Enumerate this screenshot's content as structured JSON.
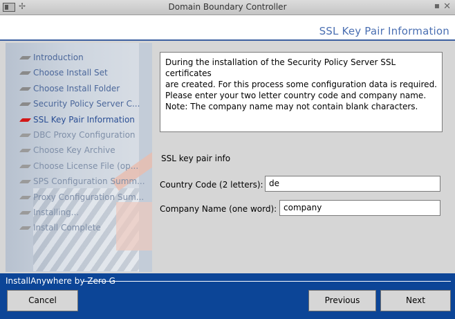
{
  "window": {
    "title": "Domain Boundary Controller",
    "pin_glyph": "✢",
    "minimize_glyph": "▪",
    "close_glyph": "✕"
  },
  "page": {
    "title": "SSL Key Pair Information"
  },
  "steps": [
    {
      "label": "Introduction",
      "state": "done"
    },
    {
      "label": "Choose Install Set",
      "state": "done"
    },
    {
      "label": "Choose Install Folder",
      "state": "done"
    },
    {
      "label": "Security Policy Server C...",
      "state": "done"
    },
    {
      "label": "SSL Key Pair Information",
      "state": "current"
    },
    {
      "label": "DBC Proxy Configuration",
      "state": "future"
    },
    {
      "label": "Choose Key Archive",
      "state": "future"
    },
    {
      "label": "Choose License File (op...",
      "state": "future"
    },
    {
      "label": "SPS Configuration Summ...",
      "state": "future"
    },
    {
      "label": "Proxy Configuration Sum...",
      "state": "future"
    },
    {
      "label": "Installing...",
      "state": "future"
    },
    {
      "label": "Install Complete",
      "state": "future"
    }
  ],
  "info_text": [
    "During the installation of the Security Policy Server SSL certificates",
    "are created. For this process some configuration data is required.",
    "Please enter your two letter country code and company name.",
    "Note: The company name may not contain blank characters."
  ],
  "section_label": "SSL key pair info",
  "form": {
    "country": {
      "label": "Country Code (2 letters):",
      "value": "de"
    },
    "company": {
      "label": "Company Name (one word):",
      "value": "company"
    }
  },
  "footer": {
    "brand": "InstallAnywhere by Zero G",
    "cancel_label": "Cancel",
    "previous_label": "Previous",
    "next_label": "Next"
  },
  "colors": {
    "header_text": "#4a6fb2",
    "footer_bg": "#0c4597",
    "current_step_bullet": "#d21818"
  }
}
